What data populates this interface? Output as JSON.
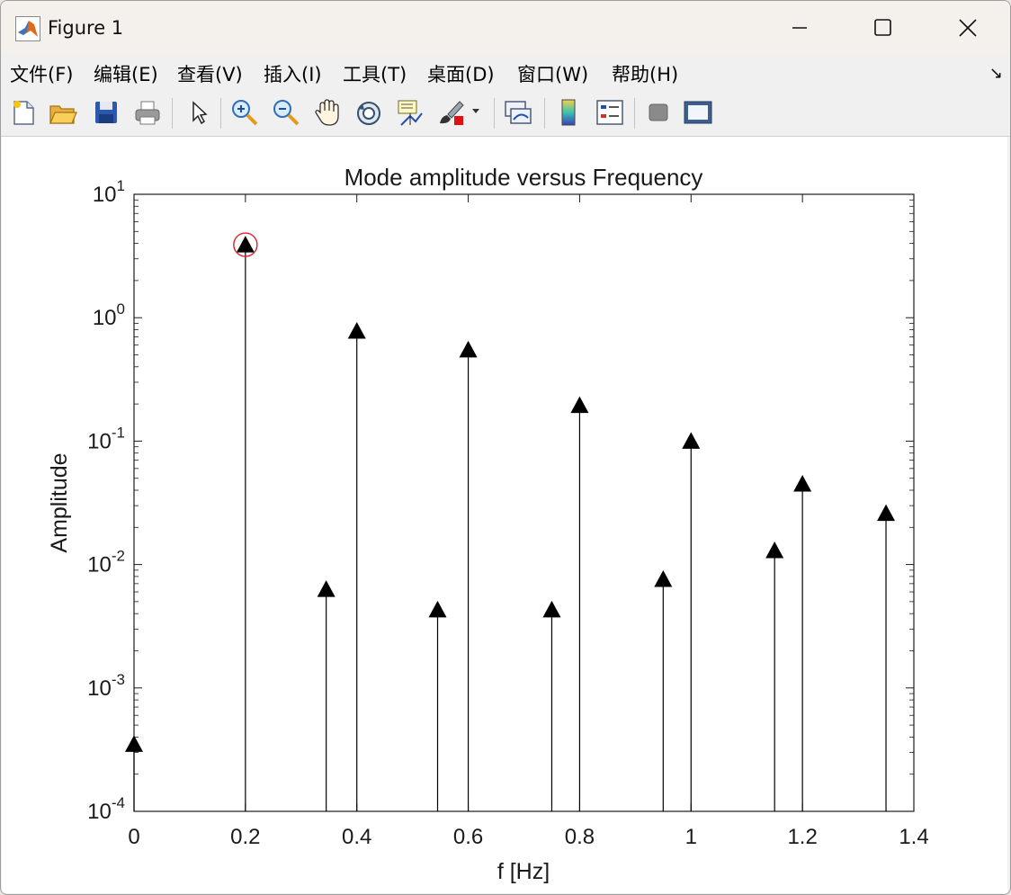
{
  "window": {
    "title": "Figure 1"
  },
  "menu": [
    {
      "label": "文件(F)"
    },
    {
      "label": "编辑(E)"
    },
    {
      "label": "查看(V)"
    },
    {
      "label": "插入(I)"
    },
    {
      "label": "工具(T)"
    },
    {
      "label": "桌面(D)"
    },
    {
      "label": "窗口(W)"
    },
    {
      "label": "帮助(H)"
    }
  ],
  "toolbar": [
    {
      "icon": "new-figure-icon"
    },
    {
      "icon": "open-file-icon"
    },
    {
      "icon": "save-icon"
    },
    {
      "icon": "print-icon"
    },
    {
      "icon": "pointer-icon"
    },
    {
      "icon": "zoom-in-icon"
    },
    {
      "icon": "zoom-out-icon"
    },
    {
      "icon": "pan-hand-icon"
    },
    {
      "icon": "rotate-3d-icon"
    },
    {
      "icon": "data-cursor-icon"
    },
    {
      "icon": "brush-icon"
    },
    {
      "icon": "link-plot-icon"
    },
    {
      "icon": "colorbar-icon"
    },
    {
      "icon": "legend-icon"
    },
    {
      "icon": "hide-plot-tools-icon"
    },
    {
      "icon": "show-plot-tools-icon"
    }
  ],
  "chart_data": {
    "type": "stem",
    "title": "Mode amplitude versus Frequency",
    "xlabel": "f [Hz]",
    "ylabel": "Amplitude",
    "xlim": [
      0,
      1.4
    ],
    "ylim": [
      0.0001,
      10
    ],
    "yscale": "log",
    "xticks": [
      "0",
      "0.2",
      "0.4",
      "0.6",
      "0.8",
      "1",
      "1.2",
      "1.4"
    ],
    "yticks": [
      {
        "base": "10",
        "exp": "-4"
      },
      {
        "base": "10",
        "exp": "-3"
      },
      {
        "base": "10",
        "exp": "-2"
      },
      {
        "base": "10",
        "exp": "-1"
      },
      {
        "base": "10",
        "exp": "0"
      },
      {
        "base": "10",
        "exp": "1"
      }
    ],
    "marker": "triangle-up",
    "color": "#000000",
    "highlight_color": "#e0202a",
    "highlighted_index": 1,
    "points": [
      {
        "x": 0.0,
        "y": 0.00035
      },
      {
        "x": 0.2,
        "y": 3.9
      },
      {
        "x": 0.345,
        "y": 0.0063
      },
      {
        "x": 0.4,
        "y": 0.78
      },
      {
        "x": 0.545,
        "y": 0.0043
      },
      {
        "x": 0.6,
        "y": 0.55
      },
      {
        "x": 0.75,
        "y": 0.0043
      },
      {
        "x": 0.8,
        "y": 0.195
      },
      {
        "x": 0.95,
        "y": 0.0076
      },
      {
        "x": 1.0,
        "y": 0.1
      },
      {
        "x": 1.15,
        "y": 0.013
      },
      {
        "x": 1.2,
        "y": 0.045
      },
      {
        "x": 1.35,
        "y": 0.026
      }
    ]
  }
}
